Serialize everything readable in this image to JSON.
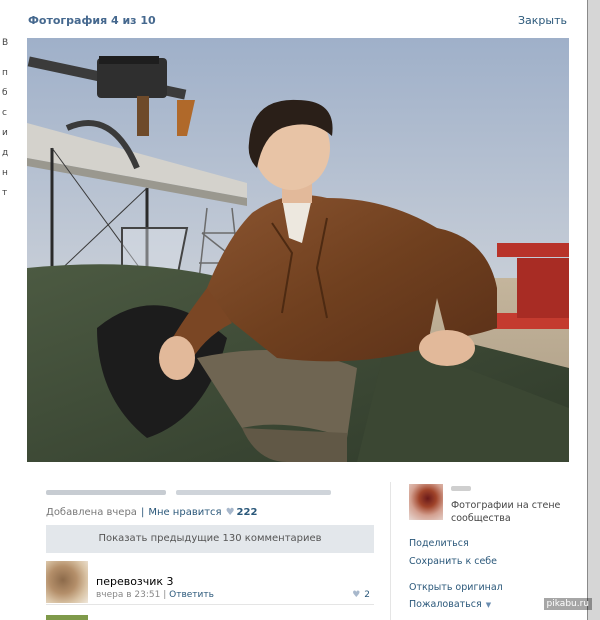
{
  "viewer": {
    "title": "Фотография 4 из 10",
    "close_label": "Закрыть"
  },
  "photo": {
    "alt": "Man in brown leather jacket sitting in a vintage biplane cockpit"
  },
  "info": {
    "added": "Добавлена вчера",
    "like_label": "Мне нравится",
    "likes_count": "222",
    "show_prev_label": "Показать предыдущие 130 комментариев"
  },
  "comment": {
    "text": "перевозчик 3",
    "time": "вчера в 23:51",
    "reply_label": "Ответить",
    "likes": "2"
  },
  "sidebar": {
    "album_name": "Фотографии на стене сообщества",
    "actions": {
      "share": "Поделиться",
      "save": "Сохранить к себе",
      "open_original": "Открыть оригинал",
      "report": "Пожаловаться"
    }
  },
  "watermark": "pikabu.ru",
  "colors": {
    "link": "#2b587a",
    "title": "#45688e",
    "button_bg": "#e3e7eb"
  }
}
